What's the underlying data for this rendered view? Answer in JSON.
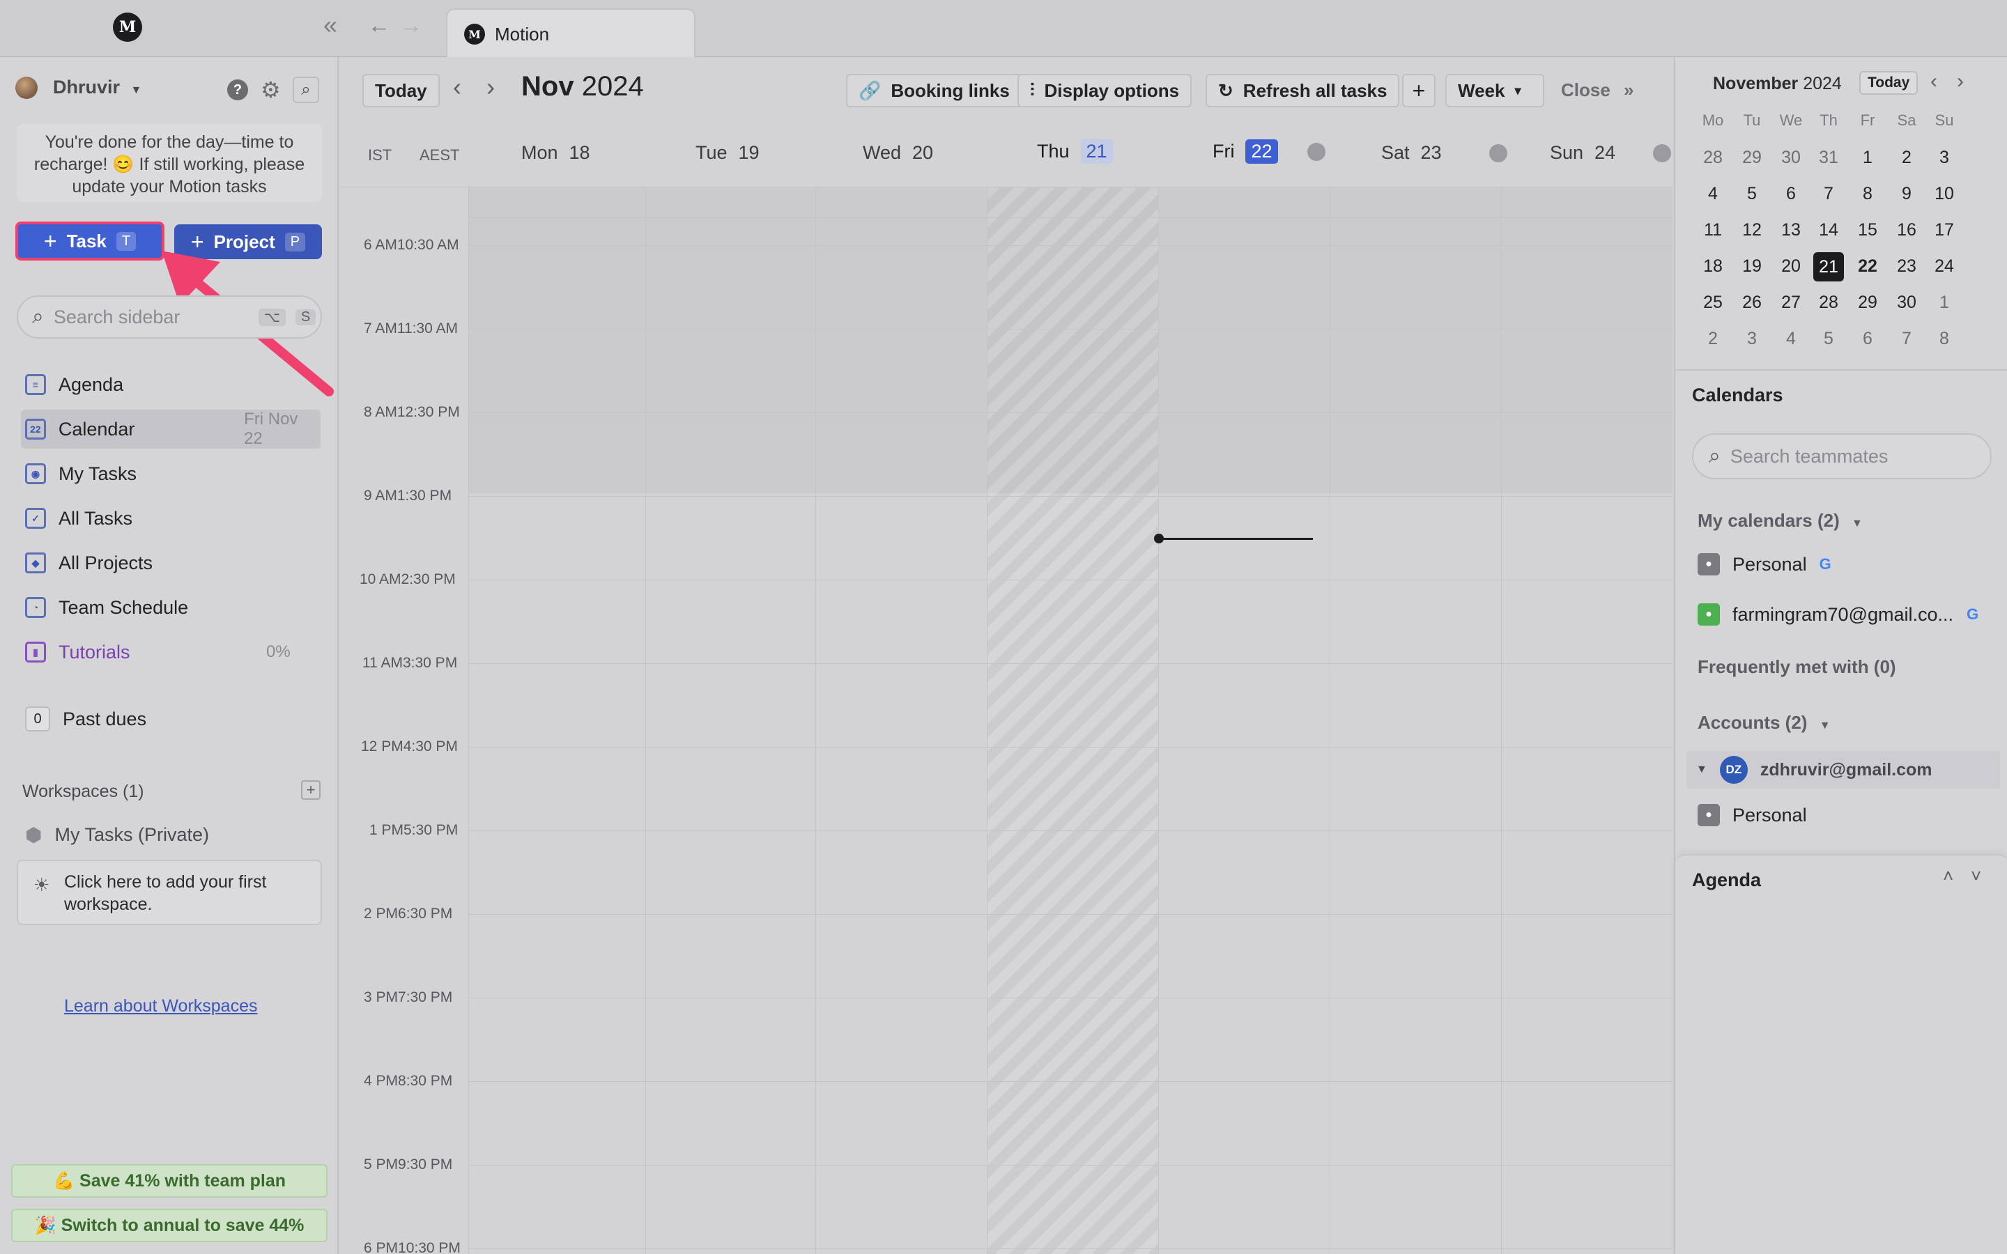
{
  "titlebar": {
    "tab_title": "Motion",
    "logo_letter": "M"
  },
  "sidebar": {
    "user_name": "Dhruvir",
    "notice": "You're done for the day—time to recharge! 😊 If still working, please update your Motion tasks",
    "task_button": {
      "label": "Task",
      "shortcut": "T"
    },
    "project_button": {
      "label": "Project",
      "shortcut": "P"
    },
    "search": {
      "placeholder": "Search sidebar",
      "shortcut_1": "⌥",
      "shortcut_2": "S"
    },
    "nav": [
      {
        "label": "Agenda",
        "meta": ""
      },
      {
        "label": "Calendar",
        "meta": "Fri Nov 22"
      },
      {
        "label": "My Tasks",
        "meta": ""
      },
      {
        "label": "All Tasks",
        "meta": ""
      },
      {
        "label": "All Projects",
        "meta": ""
      },
      {
        "label": "Team Schedule",
        "meta": ""
      },
      {
        "label": "Tutorials",
        "meta": "0%"
      }
    ],
    "past_dues": {
      "count": "0",
      "label": "Past dues"
    },
    "workspaces": {
      "heading": "Workspaces (1)",
      "item": "My Tasks (Private)",
      "card": "Click here to add your first workspace.",
      "learn_link": "Learn about Workspaces"
    },
    "promo_1": "💪 Save 41% with team plan",
    "promo_2": "🎉 Switch to annual to save 44%"
  },
  "toolbar": {
    "today": "Today",
    "month": "Nov",
    "year": "2024",
    "booking_links": "Booking links",
    "display_options": "Display options",
    "refresh": "Refresh all tasks",
    "view": "Week",
    "close": "Close"
  },
  "calendar": {
    "tz_1": "IST",
    "tz_2": "AEST",
    "days": [
      {
        "dow": "Mon",
        "num": "18"
      },
      {
        "dow": "Tue",
        "num": "19"
      },
      {
        "dow": "Wed",
        "num": "20"
      },
      {
        "dow": "Thu",
        "num": "21"
      },
      {
        "dow": "Fri",
        "num": "22"
      },
      {
        "dow": "Sat",
        "num": "23"
      },
      {
        "dow": "Sun",
        "num": "24"
      }
    ],
    "times": [
      "6 AM10:30 AM",
      "7 AM11:30 AM",
      "8 AM12:30 PM",
      "9 AM1:30 PM",
      "10 AM2:30 PM",
      "11 AM3:30 PM",
      "12 PM4:30 PM",
      "1 PM5:30 PM",
      "2 PM6:30 PM",
      "3 PM7:30 PM",
      "4 PM8:30 PM",
      "5 PM9:30 PM",
      "6 PM10:30 PM"
    ]
  },
  "mini_calendar": {
    "month": "November",
    "year": "2024",
    "today_button": "Today",
    "dow": [
      "Mo",
      "Tu",
      "We",
      "Th",
      "Fr",
      "Sa",
      "Su"
    ],
    "weeks": [
      [
        "28",
        "29",
        "30",
        "31",
        "1",
        "2",
        "3"
      ],
      [
        "4",
        "5",
        "6",
        "7",
        "8",
        "9",
        "10"
      ],
      [
        "11",
        "12",
        "13",
        "14",
        "15",
        "16",
        "17"
      ],
      [
        "18",
        "19",
        "20",
        "21",
        "22",
        "23",
        "24"
      ],
      [
        "25",
        "26",
        "27",
        "28",
        "29",
        "30",
        "1"
      ],
      [
        "2",
        "3",
        "4",
        "5",
        "6",
        "7",
        "8"
      ]
    ],
    "selected_day": "21",
    "bold_day": "22"
  },
  "right_panel": {
    "calendars_heading": "Calendars",
    "search_placeholder": "Search teammates",
    "my_calendars": "My calendars (2)",
    "cal_1": "Personal",
    "cal_2": "farmingram70@gmail.co...",
    "frequently_met": "Frequently met with (0)",
    "accounts": "Accounts (2)",
    "account_email": "zdhruvir@gmail.com",
    "account_initials": "DZ",
    "account_cal": "Personal",
    "agenda_heading": "Agenda"
  },
  "colors": {
    "accent": "#3f60d2",
    "highlight": "#f0416e",
    "google": "#4285f4",
    "calendar_green": "#4caf50"
  }
}
